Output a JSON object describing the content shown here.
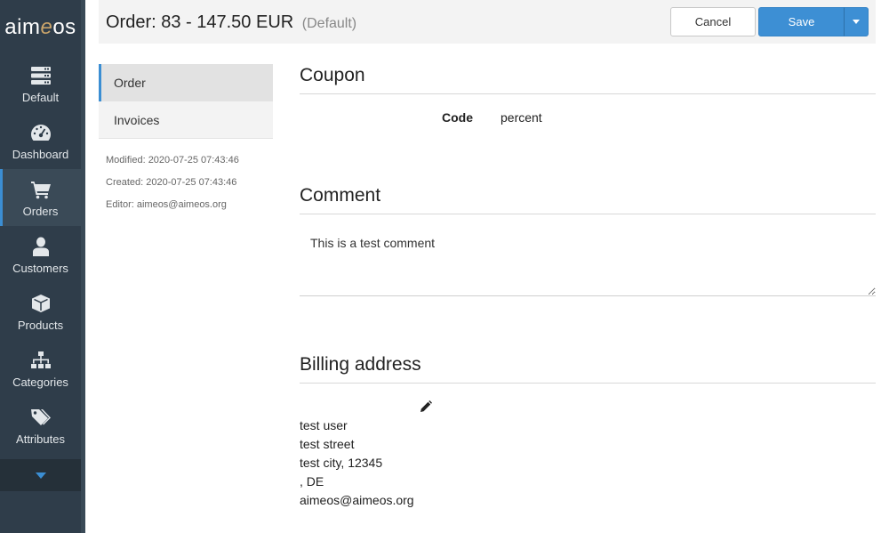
{
  "sidebar": {
    "logo_prefix": "aim",
    "logo_e": "e",
    "logo_suffix": "os",
    "items": [
      {
        "label": "Default",
        "icon": "server-icon"
      },
      {
        "label": "Dashboard",
        "icon": "dashboard-icon"
      },
      {
        "label": "Orders",
        "icon": "cart-icon",
        "active": true
      },
      {
        "label": "Customers",
        "icon": "user-icon"
      },
      {
        "label": "Products",
        "icon": "cube-icon"
      },
      {
        "label": "Categories",
        "icon": "sitemap-icon"
      },
      {
        "label": "Attributes",
        "icon": "tags-icon"
      }
    ]
  },
  "header": {
    "title": "Order: 83 - 147.50 EUR",
    "subtitle": "(Default)",
    "cancel_label": "Cancel",
    "save_label": "Save"
  },
  "left_panel": {
    "tabs": [
      "Order",
      "Invoices"
    ],
    "modified": "Modified: 2020-07-25 07:43:46",
    "created": "Created: 2020-07-25 07:43:46",
    "editor": "Editor: aimeos@aimeos.org"
  },
  "coupon": {
    "title": "Coupon",
    "code_label": "Code",
    "code_value": "percent"
  },
  "comment": {
    "title": "Comment",
    "value": "This is a test comment"
  },
  "billing": {
    "title": "Billing address",
    "lines": [
      "test user",
      "test street",
      "test city, 12345",
      ", DE",
      "aimeos@aimeos.org"
    ]
  },
  "colors": {
    "sidebar_bg": "#2f3d4a",
    "accent": "#3b8ed3",
    "save_button": "#3d8fd4"
  }
}
